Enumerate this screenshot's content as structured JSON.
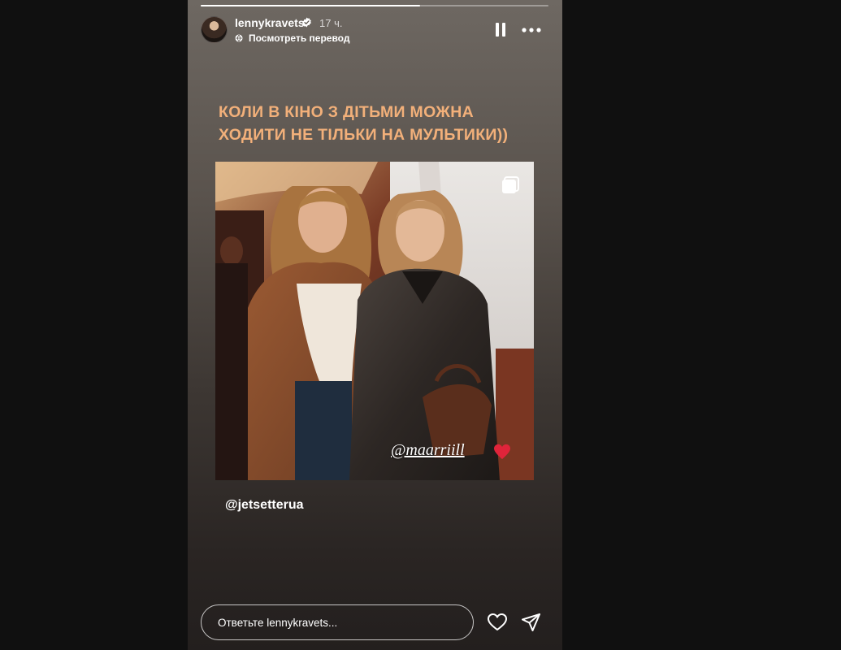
{
  "header": {
    "username": "lennykravets",
    "time_ago": "17 ч.",
    "translate_link": "Посмотреть перевод",
    "progress": 0.63
  },
  "story": {
    "headline": "КОЛИ В КІНО З ДІТЬМИ МОЖНА ХОДИТИ НЕ ТІЛЬКИ НА МУЛЬТИКИ))",
    "photo_mention": "@maarriill",
    "credit_mention": "@jetsetterua"
  },
  "footer": {
    "reply_placeholder": "Ответьте lennykravets..."
  },
  "icons": {
    "verified": "verified-badge-icon",
    "translate": "globe-icon",
    "pause": "pause-icon",
    "more": "more-horizontal-icon",
    "multi": "multiple-posts-icon",
    "like": "heart-outline-icon",
    "send": "send-paper-plane-icon",
    "heart_emoji": "red-heart-emoji"
  },
  "colors": {
    "headline": "#f2b07a",
    "verified": "#ffffff",
    "heart_emoji": "#e0243a"
  }
}
